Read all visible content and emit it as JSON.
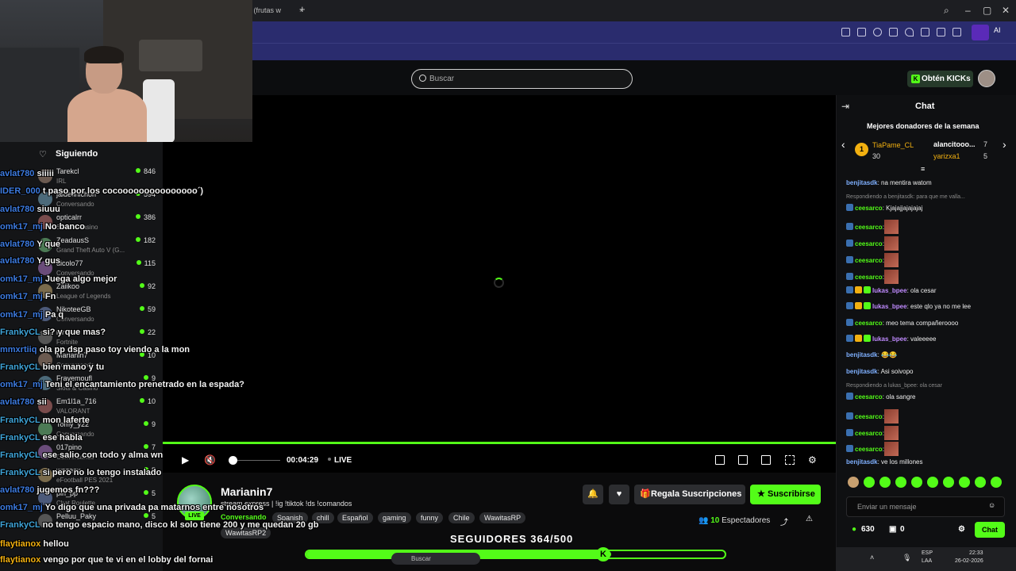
{
  "browser": {
    "tab_title": "tas (frutas w",
    "new_tab": "+",
    "ai_label": "AI"
  },
  "header": {
    "search_placeholder": "Buscar",
    "kicks_label": "Obtén KICKs"
  },
  "sidebar": {
    "heading": "Siguiendo",
    "channels": [
      {
        "name": "Tarekcl",
        "category": "IRL",
        "viewers": "846"
      },
      {
        "name": "jaidefinichon",
        "category": "Conversando",
        "viewers": "594"
      },
      {
        "name": "opticalrr",
        "category": "Slots & Casino",
        "viewers": "386"
      },
      {
        "name": "ZeadausS",
        "category": "Grand Theft Auto V (G...",
        "viewers": "182"
      },
      {
        "name": "dicolo77",
        "category": "Conversando",
        "viewers": "115"
      },
      {
        "name": "Zaiikoo",
        "category": "League of Legends",
        "viewers": "92"
      },
      {
        "name": "NikoteeGB",
        "category": "Conversando",
        "viewers": "59"
      },
      {
        "name": "ninfe",
        "category": "Fortnite",
        "viewers": "22"
      },
      {
        "name": "Marianin7",
        "category": "Conversando",
        "viewers": "10"
      },
      {
        "name": "Frayemoufl",
        "category": "Slots & Casino",
        "viewers": "9"
      },
      {
        "name": "Em1l1a_716",
        "category": "VALORANT",
        "viewers": "10"
      },
      {
        "name": "Tomy_y22",
        "category": "Conversando",
        "viewers": "9"
      },
      {
        "name": "017pino",
        "category": "Conversando",
        "viewers": "7"
      },
      {
        "name": "wezeex",
        "category": "eFootball PES 2021",
        "viewers": "5"
      },
      {
        "name": "piri_pp",
        "category": "Chat Roulette",
        "viewers": "5"
      },
      {
        "name": "Pelluu_Paky",
        "category": "",
        "viewers": "5"
      }
    ]
  },
  "overlay_chat": [
    {
      "user": "avlat780",
      "msg": "siiiii"
    },
    {
      "user": "IDER_000",
      "msg": "t paso por los cocooooooooooooooo´)"
    },
    {
      "user": "avlat780",
      "msg": "siuuu"
    },
    {
      "user": "omk17_mj",
      "msg": "No banco"
    },
    {
      "user": "avlat780",
      "msg": "Y que"
    },
    {
      "user": "avlat780",
      "msg": "Y gus"
    },
    {
      "user": "omk17_mj",
      "msg": "Juega algo mejor"
    },
    {
      "user": "omk17_mj",
      "msg": "Fn"
    },
    {
      "user": "omk17_mj",
      "msg": "Pa q"
    },
    {
      "user": "FrankyCL",
      "msg": "si? y que mas?"
    },
    {
      "user": "mmxrtiiq",
      "msg": "ola pp dsp paso toy viendo a la mon"
    },
    {
      "user": "FrankyCL",
      "msg": "bien mano y tu"
    },
    {
      "user": "omk17_mj",
      "msg": "Teni el encantamiento prenetrado en la espada?"
    },
    {
      "user": "avlat780",
      "msg": "sii"
    },
    {
      "user": "FrankyCL",
      "msg": "mon laferte"
    },
    {
      "user": "FrankyCL",
      "msg": "ese habla"
    },
    {
      "user": "FrankyCL",
      "msg": "ese salio con todo y alma wn"
    },
    {
      "user": "FrankyCL",
      "msg": "si pero no lo tengo instalado"
    },
    {
      "user": "avlat780",
      "msg": "jugemos fn???"
    },
    {
      "user": "omk17_mj",
      "msg": "Yo digo que una privada pa matarnos entre nosotros"
    },
    {
      "user": "FrankyCL",
      "msg": "no tengo espacio mano, disco kl solo tiene 200 y me quedan 20 gb"
    },
    {
      "user": "flaytianox",
      "msg": "hellou"
    },
    {
      "user": "flaytianox",
      "msg": "vengo por que te vi en el lobby del fornai"
    }
  ],
  "player": {
    "time": "00:04:29",
    "live_label": "LIVE"
  },
  "channel": {
    "name": "Marianin7",
    "title": "stream express | !ig !tiktok !ds !comandos",
    "category": "Conversando",
    "live_badge": "LIVE",
    "tags": [
      "Spanish",
      "chill",
      "Español",
      "gaming",
      "funny",
      "Chile",
      "WawitasRP",
      "WawitasRP2"
    ],
    "gift_label": "Regala Suscripciones",
    "subscribe_label": "Suscribirse",
    "viewers_count": "10",
    "viewers_label": "Espectadores",
    "followers_text": "SEGUIDORES 364/500",
    "followers_current": 364,
    "followers_goal": 500
  },
  "chat": {
    "title": "Chat",
    "donors_title": "Mejores donadores de la semana",
    "donor1": {
      "rank": "1",
      "name": "TiaPame_CL",
      "amount": "30"
    },
    "donor2": {
      "name": "alancitooo...",
      "amount": "7"
    },
    "donor3": {
      "name": "yarizxa1",
      "amount": "5"
    },
    "messages": [
      {
        "type": "msg",
        "user": "benjitasdk",
        "color": "#7fb0ff",
        "text": ": na mentira watom"
      },
      {
        "type": "reply",
        "text": "Respondiendo a benjitasdk: para que me valla..."
      },
      {
        "type": "msg",
        "user": "ceesarco",
        "color": "#53fc18",
        "text": ": Kjajajjajajajaj"
      },
      {
        "type": "emote",
        "user": "ceesarco",
        "color": "#53fc18",
        "text": ":"
      },
      {
        "type": "emote",
        "user": "ceesarco",
        "color": "#53fc18",
        "text": ":"
      },
      {
        "type": "emote",
        "user": "ceesarco",
        "color": "#53fc18",
        "text": ":"
      },
      {
        "type": "emote",
        "user": "ceesarco",
        "color": "#53fc18",
        "text": ":"
      },
      {
        "type": "msg",
        "user": "lukas_bpee",
        "color": "#c08bff",
        "text": ": ola cesar"
      },
      {
        "type": "msg",
        "user": "lukas_bpee",
        "color": "#c08bff",
        "text": ": este qlo ya no me lee"
      },
      {
        "type": "msg",
        "user": "ceesarco",
        "color": "#53fc18",
        "text": ": meo tema compañeroooo"
      },
      {
        "type": "msg",
        "user": "lukas_bpee",
        "color": "#c08bff",
        "text": ": valeeeee"
      },
      {
        "type": "msg",
        "user": "benjitasdk",
        "color": "#7fb0ff",
        "text": ": 😂😂"
      },
      {
        "type": "msg",
        "user": "benjitasdk",
        "color": "#7fb0ff",
        "text": ": Asi soivopo"
      },
      {
        "type": "reply",
        "text": "Respondiendo a lukas_bpee: ola cesar"
      },
      {
        "type": "msg",
        "user": "ceesarco",
        "color": "#53fc18",
        "text": ": ola sangre"
      },
      {
        "type": "emote",
        "user": "ceesarco",
        "color": "#53fc18",
        "text": ":"
      },
      {
        "type": "emote",
        "user": "ceesarco",
        "color": "#53fc18",
        "text": ":"
      },
      {
        "type": "emote",
        "user": "ceesarco",
        "color": "#53fc18",
        "text": ":"
      },
      {
        "type": "msg",
        "user": "benjitasdk",
        "color": "#7fb0ff",
        "text": ": ve los millones"
      }
    ],
    "input_placeholder": "Enviar un mensaje",
    "points": "630",
    "gifts": "0",
    "send_label": "Chat"
  },
  "taskbar": {
    "search": "Buscar",
    "lang": "ESP",
    "lang2": "LAA",
    "time": "22:33",
    "date": "26-02-2026"
  },
  "colors": {
    "accent": "#53fc18",
    "overlay_user": "#3d7be0"
  }
}
